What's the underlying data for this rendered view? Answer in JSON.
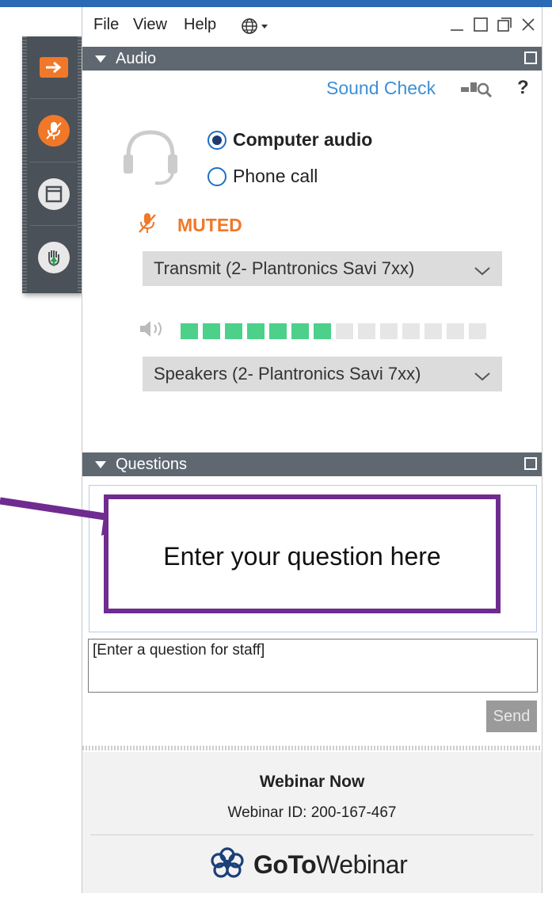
{
  "menu": {
    "file": "File",
    "view": "View",
    "help": "Help"
  },
  "audio": {
    "header": "Audio",
    "sound_check": "Sound Check",
    "help": "?",
    "options": [
      {
        "label": "Computer audio",
        "selected": true
      },
      {
        "label": "Phone call",
        "selected": false
      }
    ],
    "mic_status": "MUTED",
    "transmit_device": "Transmit (2- Plantronics Savi 7xx)",
    "speaker_level": {
      "filled": 7,
      "total": 14
    },
    "speaker_device": "Speakers (2- Plantronics Savi 7xx)"
  },
  "questions": {
    "header": "Questions",
    "input_placeholder": "[Enter a question for staff]",
    "send_label": "Send"
  },
  "footer": {
    "title": "Webinar Now",
    "webinar_id": "Webinar ID: 200-167-467",
    "brand_bold": "GoTo",
    "brand_regular": "Webinar"
  },
  "annotation": {
    "text": "Enter your question here"
  },
  "colors": {
    "accent_orange": "#f07828",
    "link_blue": "#3d8fd6",
    "header_gray": "#5f6870",
    "level_green": "#4cd08a",
    "annotation_purple": "#6f2b8f"
  }
}
